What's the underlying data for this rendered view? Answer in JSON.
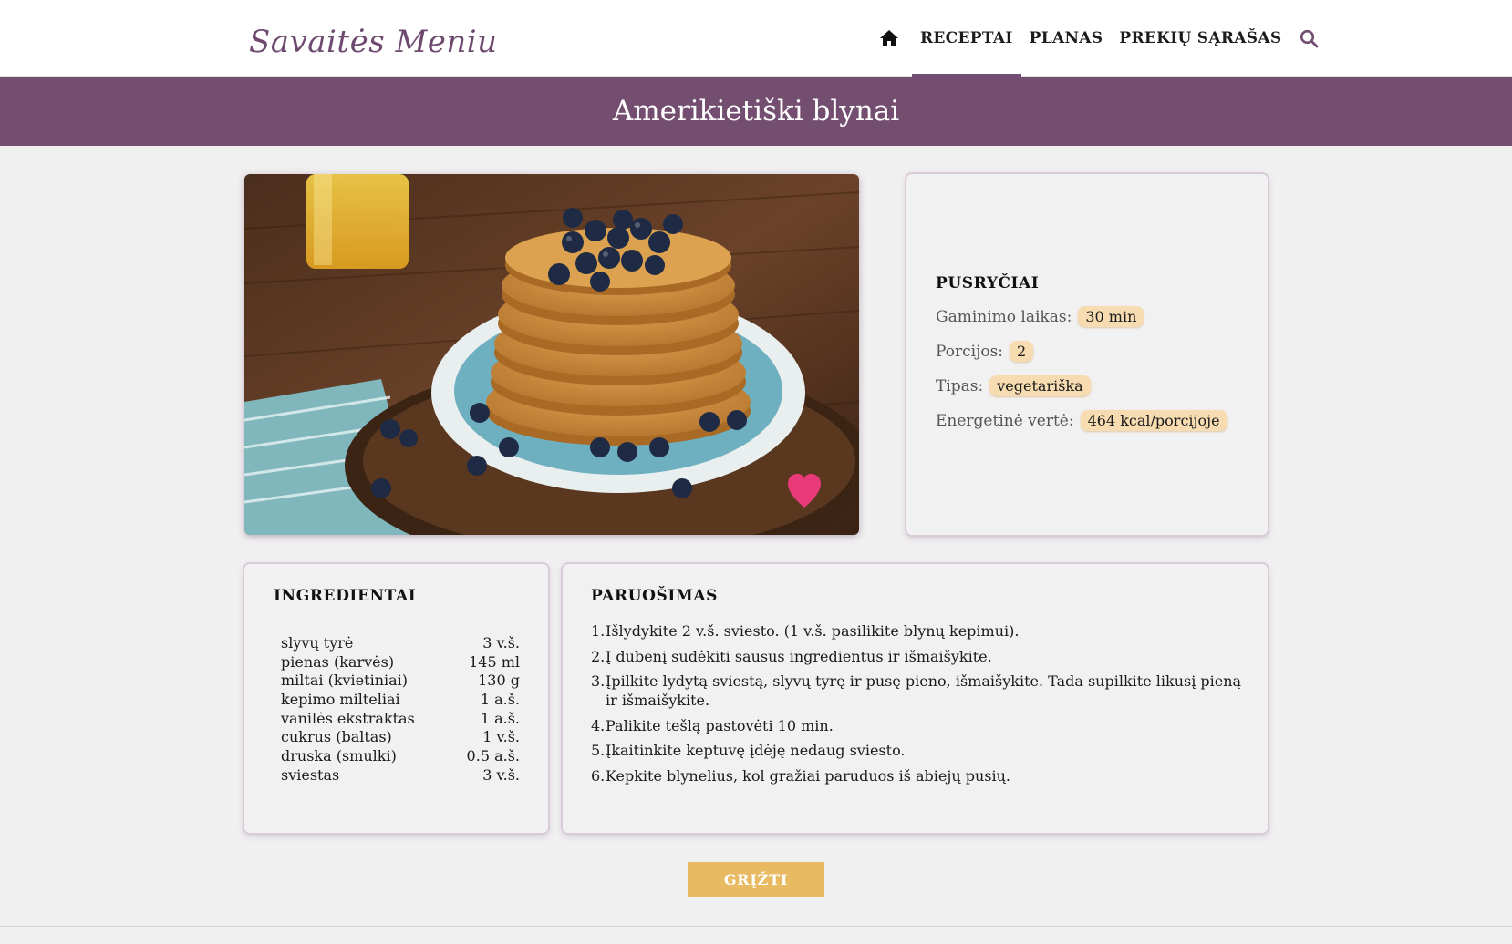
{
  "colors": {
    "brand": "#744e70",
    "accent": "#e8bb62",
    "pill": "#f6dcb0",
    "heart": "#e83a78"
  },
  "header": {
    "logo": "Savaitės Meniu",
    "nav": {
      "home_icon": "home-icon",
      "items": [
        {
          "label": "RECEPTAI",
          "active": true
        },
        {
          "label": "PLANAS",
          "active": false
        },
        {
          "label": "PREKIŲ SĄRAŠAS",
          "active": false
        }
      ],
      "search_icon": "search-icon"
    }
  },
  "page": {
    "title": "Amerikietiški blynai"
  },
  "hero": {
    "favorite_icon": "heart-icon"
  },
  "info": {
    "category": "PUSRYČIAI",
    "rows": [
      {
        "label": "Gaminimo laikas:",
        "value": "30 min"
      },
      {
        "label": "Porcijos:",
        "value": "2"
      },
      {
        "label": "Tipas:",
        "value": "vegetariška"
      },
      {
        "label": "Energetinė vertė:",
        "value": "464 kcal/porcijoje"
      }
    ]
  },
  "ingredients": {
    "heading": "INGREDIENTAI",
    "items": [
      {
        "name": "slyvų tyrė",
        "amount": "3 v.š."
      },
      {
        "name": "pienas (karvės)",
        "amount": "145 ml"
      },
      {
        "name": "miltai (kvietiniai)",
        "amount": "130 g"
      },
      {
        "name": "kepimo milteliai",
        "amount": "1 a.š."
      },
      {
        "name": "vanilės ekstraktas",
        "amount": "1 a.š."
      },
      {
        "name": "cukrus (baltas)",
        "amount": "1 v.š."
      },
      {
        "name": "druska (smulki)",
        "amount": "0.5 a.š."
      },
      {
        "name": "sviestas",
        "amount": "3 v.š."
      }
    ]
  },
  "preparation": {
    "heading": "PARUOŠIMAS",
    "steps": [
      {
        "num": "1.",
        "text": "Išlydykite 2 v.š. sviesto. (1 v.š. pasilikite blynų kepimui)."
      },
      {
        "num": "2.",
        "text": "Į dubenį sudėkiti sausus ingredientus ir išmaišykite."
      },
      {
        "num": "3.",
        "text": "Įpilkite lydytą sviestą, slyvų tyrę ir pusę pieno, išmaišykite. Tada supilkite likusį pieną ir išmaišykite."
      },
      {
        "num": "4.",
        "text": "Palikite tešlą pastovėti 10 min."
      },
      {
        "num": "5.",
        "text": "Įkaitinkite keptuvę įdėję nedaug sviesto."
      },
      {
        "num": "6.",
        "text": "Kepkite blynelius, kol gražiai paruduos iš abiejų pusių."
      }
    ]
  },
  "actions": {
    "back_label": "GRĮŽTI"
  }
}
